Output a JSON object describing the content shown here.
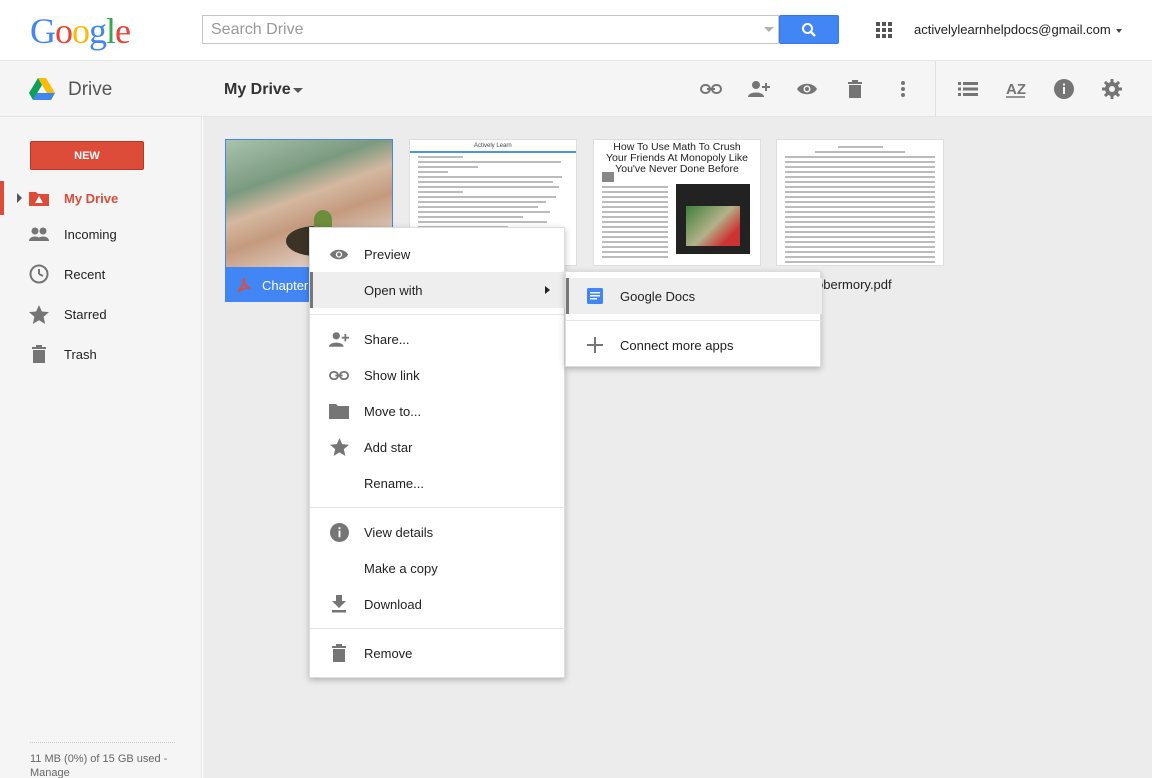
{
  "header": {
    "logo_text": "Google",
    "search_placeholder": "Search Drive",
    "account": "activelylearnhelpdocs@gmail.com"
  },
  "toolbar": {
    "app_name": "Drive",
    "breadcrumb": "My Drive"
  },
  "sidebar": {
    "new_label": "NEW",
    "items": [
      {
        "label": "My Drive",
        "icon": "my-drive-icon"
      },
      {
        "label": "Incoming",
        "icon": "people-icon"
      },
      {
        "label": "Recent",
        "icon": "clock-icon"
      },
      {
        "label": "Starred",
        "icon": "star-icon"
      },
      {
        "label": "Trash",
        "icon": "trash-icon"
      }
    ],
    "quota_line1": "11 MB (0%) of 15 GB used -",
    "quota_line2": "Manage"
  },
  "files": {
    "chapter_label": "Chapter",
    "tile2_title": "Actively Learn",
    "tile3_title": "How To Use Math To Crush Your Friends At Monopoly Like You've Never Done Before",
    "tile4_label": "obermory.pdf"
  },
  "context_menu": {
    "items": [
      {
        "label": "Preview"
      },
      {
        "label": "Open with"
      },
      {
        "label": "Share..."
      },
      {
        "label": "Show link"
      },
      {
        "label": "Move to..."
      },
      {
        "label": "Add star"
      },
      {
        "label": "Rename..."
      },
      {
        "label": "View details"
      },
      {
        "label": "Make a copy"
      },
      {
        "label": "Download"
      },
      {
        "label": "Remove"
      }
    ]
  },
  "submenu": {
    "items": [
      {
        "label": "Google Docs"
      },
      {
        "label": "Connect more apps"
      }
    ]
  },
  "colors": {
    "accent_red": "#dd4b39",
    "accent_blue": "#4285f4"
  }
}
